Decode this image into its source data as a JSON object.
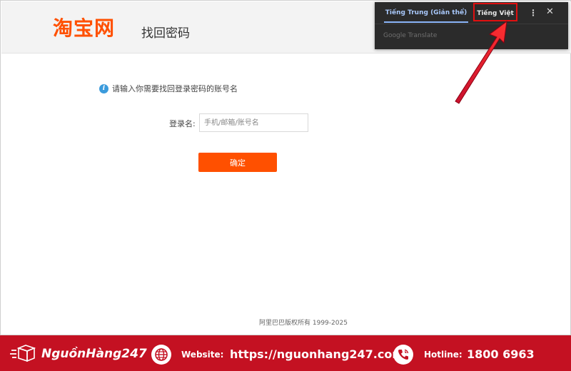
{
  "header": {
    "logo_text": "淘宝网",
    "title": "找回密码"
  },
  "form": {
    "hint": "请输入你需要找回登录密码的账号名",
    "username_label": "登录名:",
    "username_placeholder": "手机/邮箱/账号名",
    "username_value": "",
    "confirm_label": "确定"
  },
  "footer_copyright": "阿里巴巴版权所有 1999-2025",
  "translate": {
    "source_language": "Tiếng Trung (Giản thể)",
    "target_language": "Tiếng Việt",
    "powered_by": "Google Translate"
  },
  "banner": {
    "brand": "NguồnHàng247",
    "website_label": "Website:",
    "website_url": "https://nguonhang247.com/",
    "hotline_label": "Hotline:",
    "hotline_number": "1800 6963"
  },
  "colors": {
    "brand_orange": "#ff5000",
    "banner_red": "#c41122",
    "highlight_red": "#e01010",
    "info_blue": "#3b9bdc"
  },
  "icons": [
    "info-icon",
    "kebab-menu-icon",
    "close-icon",
    "globe-icon",
    "phone-icon",
    "delivery-box-icon"
  ]
}
